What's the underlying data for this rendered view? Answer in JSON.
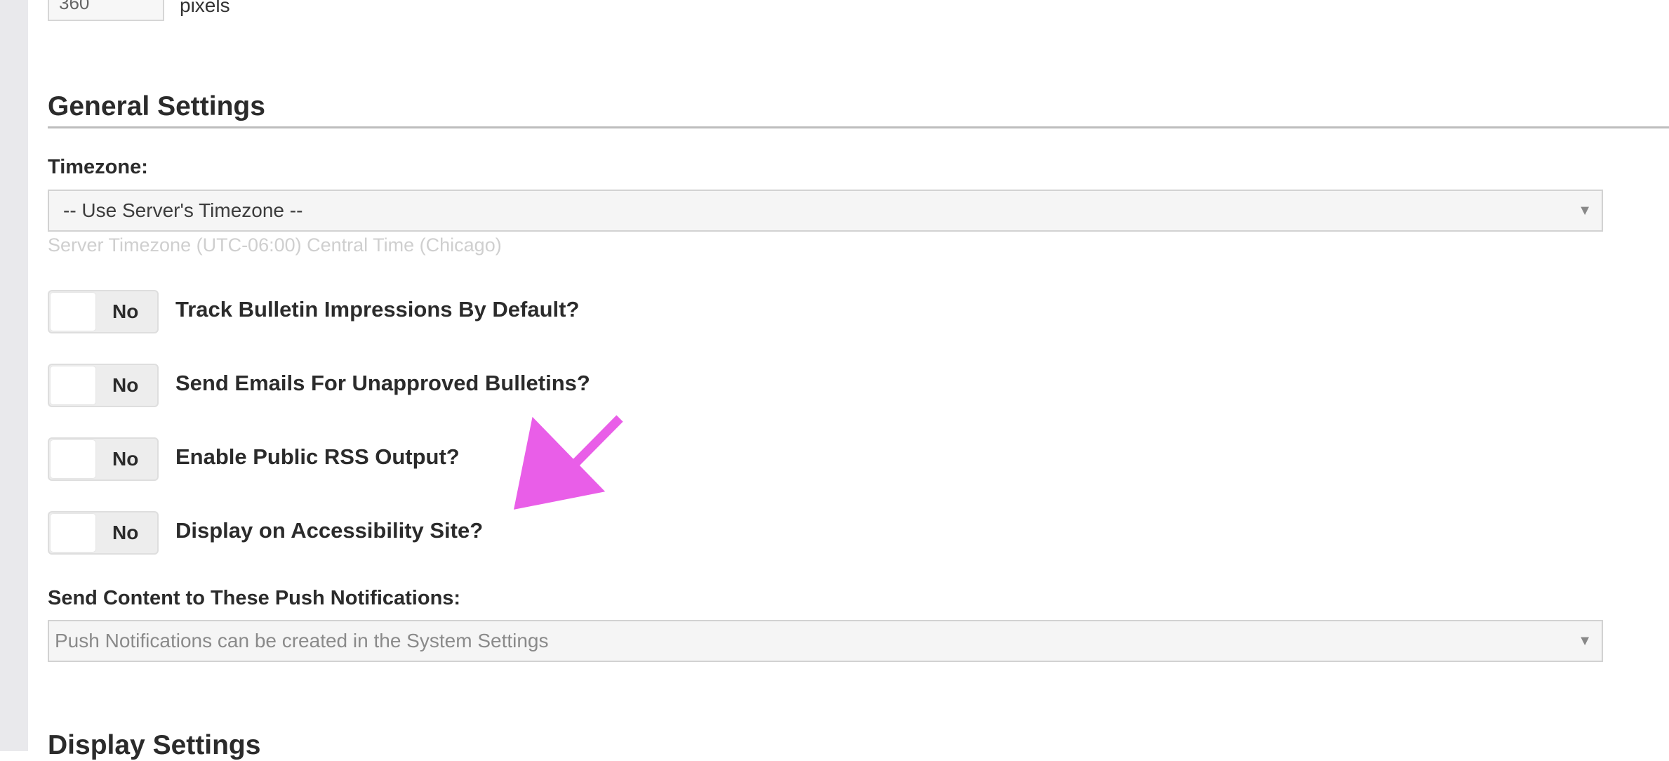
{
  "top_row": {
    "pixels_value": "360",
    "pixels_unit": "pixels"
  },
  "general_settings": {
    "title": "General Settings",
    "timezone": {
      "label": "Timezone:",
      "selected": "-- Use Server's Timezone --",
      "helper": "Server Timezone (UTC-06:00) Central Time (Chicago)"
    },
    "toggles": [
      {
        "state": "No",
        "label": "Track Bulletin Impressions By Default?"
      },
      {
        "state": "No",
        "label": "Send Emails For Unapproved Bulletins?"
      },
      {
        "state": "No",
        "label": "Enable Public RSS Output?"
      },
      {
        "state": "No",
        "label": "Display on Accessibility Site?"
      }
    ],
    "push_notifications": {
      "label": "Send Content to These Push Notifications:",
      "placeholder": "Push Notifications can be created in the System Settings"
    }
  },
  "display_settings": {
    "title": "Display Settings"
  },
  "colors": {
    "annotation_arrow": "#e95ee8",
    "toggle_bg": "#ededed",
    "select_bg": "#f5f5f5",
    "rule": "#bdbdbd"
  },
  "icons": {
    "select_arrow": "caret-down-icon",
    "annotation": "arrow-annotation-icon"
  }
}
